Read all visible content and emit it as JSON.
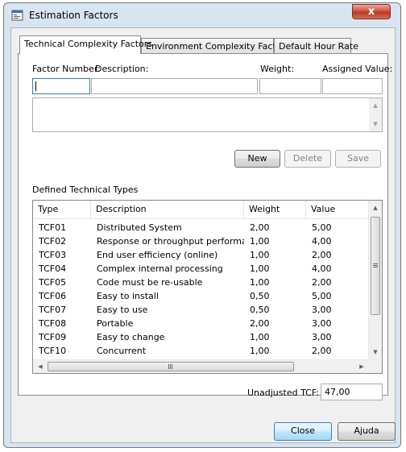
{
  "window": {
    "title": "Estimation Factors",
    "close_glyph": "x"
  },
  "tabs": [
    {
      "label": "Technical Complexity Factors"
    },
    {
      "label": "Environment Complexity Factors"
    },
    {
      "label": "Default Hour Rate"
    }
  ],
  "form": {
    "factor_number_label": "Factor Number:",
    "description_label": "Description:",
    "weight_label": "Weight:",
    "assigned_value_label": "Assigned Value:",
    "factor_number_value": "",
    "description_value": "",
    "weight_value": "",
    "assigned_value_value": "",
    "notes_value": ""
  },
  "buttons": {
    "new": "New",
    "delete": "Delete",
    "save": "Save",
    "close": "Close",
    "help": "Ajuda"
  },
  "list": {
    "section_label": "Defined Technical Types",
    "columns": [
      "Type",
      "Description",
      "Weight",
      "Value"
    ],
    "rows": [
      {
        "type": "TCF01",
        "description": "Distributed System",
        "weight": "2,00",
        "value": "5,00"
      },
      {
        "type": "TCF02",
        "description": "Response or throughput performan...",
        "weight": "1,00",
        "value": "4,00"
      },
      {
        "type": "TCF03",
        "description": "End user efficiency (online)",
        "weight": "1,00",
        "value": "2,00"
      },
      {
        "type": "TCF04",
        "description": "Complex internal processing",
        "weight": "1,00",
        "value": "4,00"
      },
      {
        "type": "TCF05",
        "description": "Code must be re-usable",
        "weight": "1,00",
        "value": "2,00"
      },
      {
        "type": "TCF06",
        "description": "Easy to install",
        "weight": "0,50",
        "value": "5,00"
      },
      {
        "type": "TCF07",
        "description": "Easy to use",
        "weight": "0,50",
        "value": "3,00"
      },
      {
        "type": "TCF08",
        "description": "Portable",
        "weight": "2,00",
        "value": "3,00"
      },
      {
        "type": "TCF09",
        "description": "Easy to change",
        "weight": "1,00",
        "value": "3,00"
      },
      {
        "type": "TCF10",
        "description": "Concurrent",
        "weight": "1,00",
        "value": "2,00"
      }
    ]
  },
  "summary": {
    "unadjusted_label": "Unadjusted TCF:",
    "unadjusted_value": "47,00"
  },
  "icons": {
    "app": "window-app-icon",
    "close": "close-icon",
    "scroll_up": "chevron-up-icon",
    "scroll_down": "chevron-down-icon",
    "scroll_left": "chevron-left-icon",
    "scroll_right": "chevron-right-icon"
  }
}
